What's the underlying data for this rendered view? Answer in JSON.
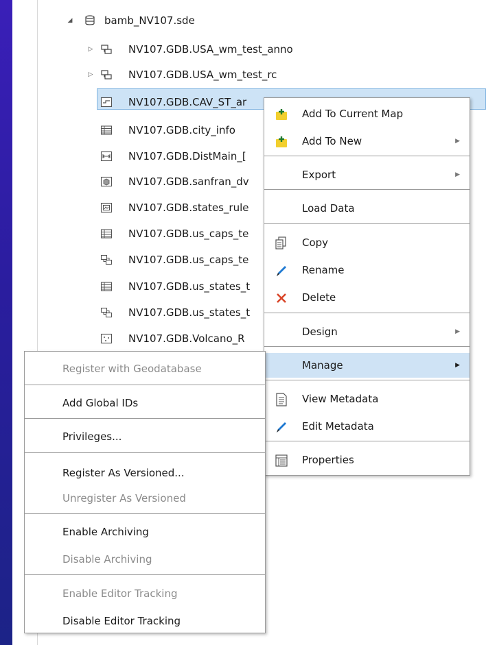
{
  "tree": {
    "root": {
      "label": "bamb_NV107.sde",
      "expander": "◢",
      "icon": "database-icon"
    },
    "items": [
      {
        "label": "NV107.GDB.USA_wm_test_anno",
        "expander": "▷",
        "icon": "feature-dataset-icon"
      },
      {
        "label": "NV107.GDB.USA_wm_test_rc",
        "expander": "▷",
        "icon": "feature-dataset-icon"
      },
      {
        "label": "NV107.GDB.CAV_ST_ar",
        "expander": "",
        "icon": "line-feature-class-icon"
      },
      {
        "label": "NV107.GDB.city_info",
        "expander": "",
        "icon": "table-icon"
      },
      {
        "label": "NV107.GDB.DistMain_[",
        "expander": "",
        "icon": "dimension-icon"
      },
      {
        "label": "NV107.GDB.sanfran_dv",
        "expander": "",
        "icon": "multipatch-icon"
      },
      {
        "label": "NV107.GDB.states_rule",
        "expander": "",
        "icon": "raster-icon"
      },
      {
        "label": "NV107.GDB.us_caps_te",
        "expander": "",
        "icon": "table-icon"
      },
      {
        "label": "NV107.GDB.us_caps_te",
        "expander": "",
        "icon": "relationship-class-icon"
      },
      {
        "label": "NV107.GDB.us_states_t",
        "expander": "",
        "icon": "table-icon"
      },
      {
        "label": "NV107.GDB.us_states_t",
        "expander": "",
        "icon": "relationship-class-icon"
      },
      {
        "label": "NV107.GDB.Volcano_R",
        "expander": "",
        "icon": "point-feature-class-icon"
      }
    ]
  },
  "context_menu": {
    "items": [
      {
        "label": "Add To Current Map",
        "icon": "add-data-icon",
        "arrow": ""
      },
      {
        "label": "Add To New",
        "icon": "add-data-icon",
        "arrow": "▶"
      },
      {
        "label": "Export",
        "icon": "",
        "arrow": "▶"
      },
      {
        "label": "Load Data",
        "icon": "",
        "arrow": ""
      },
      {
        "label": "Copy",
        "icon": "copy-icon",
        "arrow": ""
      },
      {
        "label": "Rename",
        "icon": "pencil-icon",
        "arrow": ""
      },
      {
        "label": "Delete",
        "icon": "delete-x-icon",
        "arrow": ""
      },
      {
        "label": "Design",
        "icon": "",
        "arrow": "▶"
      },
      {
        "label": "Manage",
        "icon": "",
        "arrow": "▶"
      },
      {
        "label": "View Metadata",
        "icon": "metadata-icon",
        "arrow": ""
      },
      {
        "label": "Edit Metadata",
        "icon": "pencil-icon",
        "arrow": ""
      },
      {
        "label": "Properties",
        "icon": "properties-icon",
        "arrow": ""
      }
    ]
  },
  "manage_submenu": {
    "items": [
      {
        "label": "Register with Geodatabase",
        "enabled": false
      },
      {
        "label": "Add Global IDs",
        "enabled": true
      },
      {
        "label": "Privileges...",
        "enabled": true
      },
      {
        "label": "Register As Versioned...",
        "enabled": true
      },
      {
        "label": "Unregister As Versioned",
        "enabled": false
      },
      {
        "label": "Enable Archiving",
        "enabled": true
      },
      {
        "label": "Disable Archiving",
        "enabled": false
      },
      {
        "label": "Enable Editor Tracking",
        "enabled": false
      },
      {
        "label": "Disable Editor Tracking",
        "enabled": true
      }
    ]
  },
  "colors": {
    "highlight": "#cfe3f5",
    "selection_border": "#7fb3e0",
    "delete_red": "#d9472b",
    "add_yellow": "#f2cf2d",
    "pencil_blue": "#1f79d2",
    "disabled_text": "#8b8b8b"
  }
}
